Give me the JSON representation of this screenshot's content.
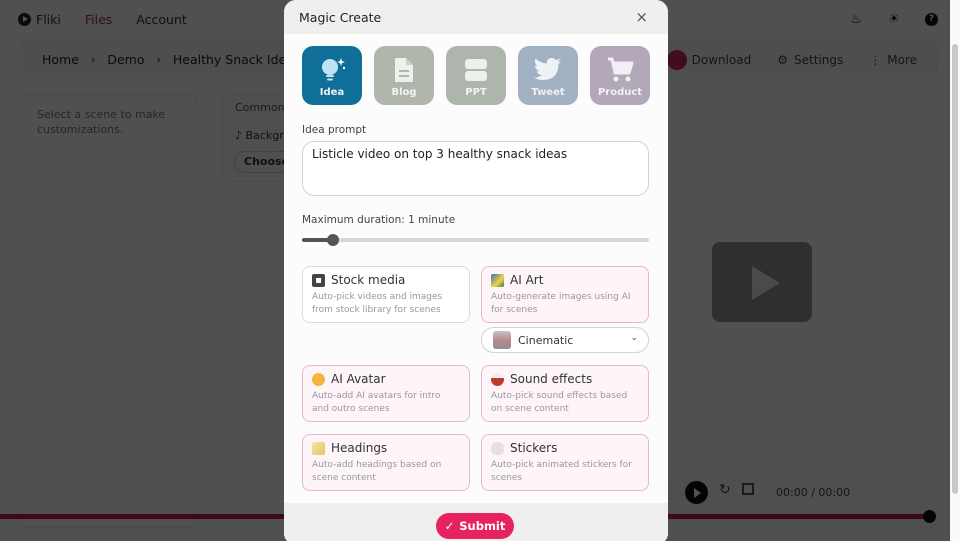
{
  "app": {
    "brand": "Fliki",
    "nav": [
      "Files",
      "Account"
    ],
    "active_nav": "Files",
    "top_icons": [
      "fire-icon",
      "sun-icon",
      "help-icon"
    ]
  },
  "breadcrumb": {
    "items": [
      "Home",
      "Demo",
      "Healthy Snack Ideas"
    ],
    "separator": "›",
    "actions": [
      {
        "icon": "download-icon",
        "label": "Download"
      },
      {
        "icon": "gear-icon",
        "label": "Settings"
      },
      {
        "icon": "more-vertical-icon",
        "label": "More"
      }
    ]
  },
  "left_panel": {
    "hint": "Select a scene to make customizations."
  },
  "common_panel": {
    "title": "Common s",
    "background_label": "Backgr",
    "choose_label": "Choose t"
  },
  "player": {
    "timecode": "00:00 / 00:00",
    "progress": 1.0
  },
  "modal": {
    "title": "Magic Create",
    "close_label": "×",
    "types": [
      {
        "label": "Idea",
        "icon": "lightbulb-icon",
        "color": "#0f6f99",
        "selected": true
      },
      {
        "label": "Blog",
        "icon": "document-icon",
        "color": "#b0b6ac",
        "selected": false
      },
      {
        "label": "PPT",
        "icon": "slides-icon",
        "color": "#aeb5ad",
        "selected": false
      },
      {
        "label": "Tweet",
        "icon": "twitter-icon",
        "color": "#a2b0c4",
        "selected": false
      },
      {
        "label": "Product",
        "icon": "cart-icon",
        "color": "#b3a8ba",
        "selected": false
      }
    ],
    "prompt_label": "Idea prompt",
    "prompt_value": "Listicle video on top 3 healthy snack ideas",
    "duration_label": "Maximum duration: 1 minute",
    "duration_fraction": 0.09,
    "options": [
      {
        "title": "Stock media",
        "desc": "Auto-pick videos and images from stock library for scenes",
        "icon": "movie-camera-icon",
        "emoji": "🎥",
        "selected": false
      },
      {
        "title": "AI Art",
        "desc": "Auto-generate images using AI for scenes",
        "icon": "picture-icon",
        "emoji": "🖼",
        "selected": true
      },
      {
        "title": "AI Avatar",
        "desc": "Auto-add AI avatars for intro and outro scenes",
        "icon": "person-icon",
        "emoji": "🙋",
        "selected": true
      },
      {
        "title": "Sound effects",
        "desc": "Auto-pick sound effects based on scene content",
        "icon": "drum-icon",
        "emoji": "🥁",
        "selected": true
      },
      {
        "title": "Headings",
        "desc": "Auto-add headings based on scene content",
        "icon": "memo-icon",
        "emoji": "📝",
        "selected": true
      },
      {
        "title": "Stickers",
        "desc": "Auto-pick animated stickers for scenes",
        "icon": "rabbit-icon",
        "emoji": "🐰",
        "selected": true
      }
    ],
    "art_style": "Cinematic",
    "submit_label": "Submit",
    "accent": "#e6225f"
  }
}
